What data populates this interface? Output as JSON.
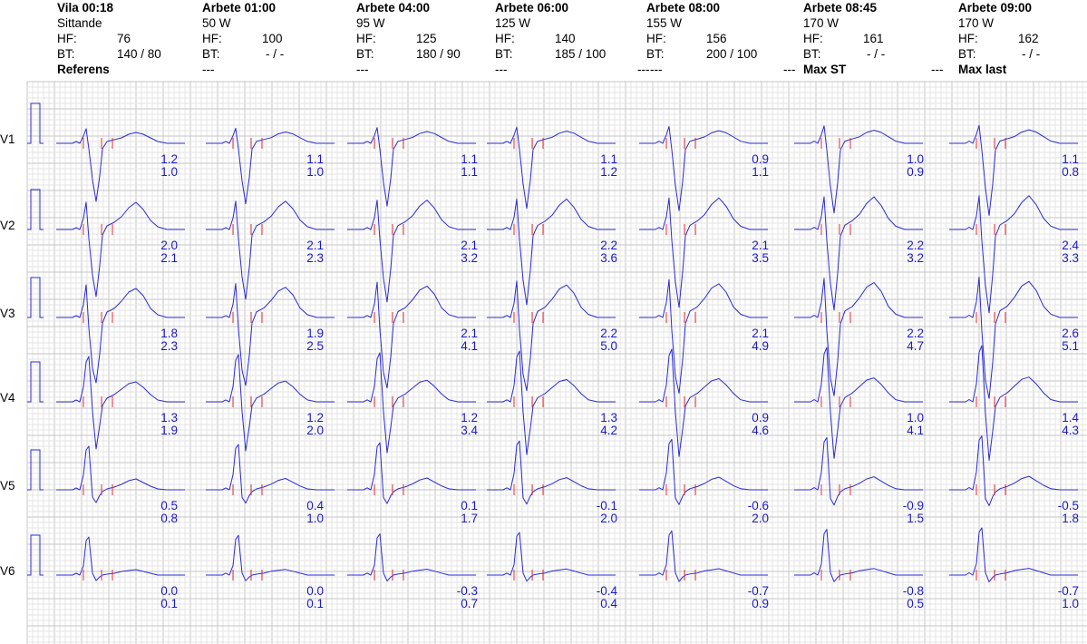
{
  "colors": {
    "trace": "#2b2bd6",
    "st_values": "#1a1acd",
    "marker": "#e0303a",
    "grid_minor": "#e4e4e4",
    "grid_major": "#c6c6c6"
  },
  "columns": [
    {
      "title": "Vila 00:18",
      "sub": "Sittande",
      "hf_label": "HF:",
      "hf": "76",
      "bt_label": "BT:",
      "bt": "140 / 80",
      "lead": "",
      "foot": "Referens",
      "foot_dash": ""
    },
    {
      "title": "Arbete 01:00",
      "sub": "50 W",
      "hf_label": "HF:",
      "hf": "100",
      "bt_label": "BT:",
      "bt": "- / -",
      "lead": "",
      "foot": "",
      "foot_dash": "---"
    },
    {
      "title": "Arbete 04:00",
      "sub": "95 W",
      "hf_label": "HF:",
      "hf": "125",
      "bt_label": "BT:",
      "bt": "180 / 90",
      "lead": "",
      "foot": "",
      "foot_dash": "---"
    },
    {
      "title": "Arbete 06:00",
      "sub": "125 W",
      "hf_label": "HF:",
      "hf": "140",
      "bt_label": "BT:",
      "bt": "185 / 100",
      "lead": "",
      "foot": "",
      "foot_dash": "---"
    },
    {
      "title": "Arbete 08:00",
      "sub": "155 W",
      "hf_label": "HF:",
      "hf": "156",
      "bt_label": "BT:",
      "bt": "200 / 100",
      "lead": "---",
      "foot": "",
      "foot_dash": "---"
    },
    {
      "title": "Arbete 08:45",
      "sub": "170 W",
      "hf_label": "HF:",
      "hf": "161",
      "bt_label": "BT:",
      "bt": "- / -",
      "lead": "---",
      "foot": "Max ST",
      "foot_dash": ""
    },
    {
      "title": "Arbete 09:00",
      "sub": "170 W",
      "hf_label": "HF:",
      "hf": "162",
      "bt_label": "BT:",
      "bt": "- / -",
      "lead": "---",
      "foot": "Max last",
      "foot_dash": ""
    }
  ],
  "chart_data": {
    "type": "ecg-st-table",
    "leads": [
      "V1",
      "V2",
      "V3",
      "V4",
      "V5",
      "V6"
    ],
    "stages": [
      "Vila 00:18",
      "Arbete 01:00",
      "Arbete 04:00",
      "Arbete 06:00",
      "Arbete 08:00",
      "Arbete 08:45",
      "Arbete 09:00"
    ],
    "st_values": [
      [
        [
          "1.2",
          "1.0"
        ],
        [
          "1.1",
          "1.0"
        ],
        [
          "1.1",
          "1.1"
        ],
        [
          "1.1",
          "1.2"
        ],
        [
          "0.9",
          "1.1"
        ],
        [
          "1.0",
          "0.9"
        ],
        [
          "1.1",
          "0.8"
        ]
      ],
      [
        [
          "2.0",
          "2.1"
        ],
        [
          "2.1",
          "2.3"
        ],
        [
          "2.1",
          "3.2"
        ],
        [
          "2.2",
          "3.6"
        ],
        [
          "2.1",
          "3.5"
        ],
        [
          "2.2",
          "3.2"
        ],
        [
          "2.4",
          "3.3"
        ]
      ],
      [
        [
          "1.8",
          "2.3"
        ],
        [
          "1.9",
          "2.5"
        ],
        [
          "2.1",
          "4.1"
        ],
        [
          "2.2",
          "5.0"
        ],
        [
          "2.1",
          "4.9"
        ],
        [
          "2.2",
          "4.7"
        ],
        [
          "2.6",
          "5.1"
        ]
      ],
      [
        [
          "1.3",
          "1.9"
        ],
        [
          "1.2",
          "2.0"
        ],
        [
          "1.2",
          "3.4"
        ],
        [
          "1.3",
          "4.2"
        ],
        [
          "0.9",
          "4.6"
        ],
        [
          "1.0",
          "4.1"
        ],
        [
          "1.4",
          "4.3"
        ]
      ],
      [
        [
          "0.5",
          "0.8"
        ],
        [
          "0.4",
          "1.0"
        ],
        [
          "0.1",
          "1.7"
        ],
        [
          "-0.1",
          "2.0"
        ],
        [
          "-0.6",
          "2.0"
        ],
        [
          "-0.9",
          "1.5"
        ],
        [
          "-0.5",
          "1.8"
        ]
      ],
      [
        [
          "0.0",
          "0.1"
        ],
        [
          "0.0",
          "0.1"
        ],
        [
          "-0.3",
          "0.7"
        ],
        [
          "-0.4",
          "0.4"
        ],
        [
          "-0.7",
          "0.9"
        ],
        [
          "-0.8",
          "0.5"
        ],
        [
          "-0.7",
          "1.0"
        ]
      ]
    ]
  }
}
